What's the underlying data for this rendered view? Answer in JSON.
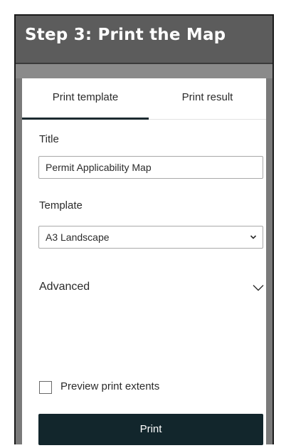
{
  "header": {
    "title": "Step 3: Print the Map"
  },
  "tabs": [
    {
      "label": "Print template",
      "selected": true
    },
    {
      "label": "Print result",
      "selected": false
    }
  ],
  "form": {
    "title_label": "Title",
    "title_value": "Permit Applicability Map",
    "template_label": "Template",
    "template_value": "A3 Landscape",
    "advanced_label": "Advanced",
    "preview_label": "Preview print extents",
    "preview_checked": false,
    "print_label": "Print"
  },
  "colors": {
    "header_bg": "#5c5c5c",
    "panel_bg": "#7a7a7a",
    "accent": "#1c2a30",
    "button_bg": "#12262c"
  },
  "icons": {
    "select": "chevron-down-icon",
    "advanced": "chevron-down-icon"
  }
}
